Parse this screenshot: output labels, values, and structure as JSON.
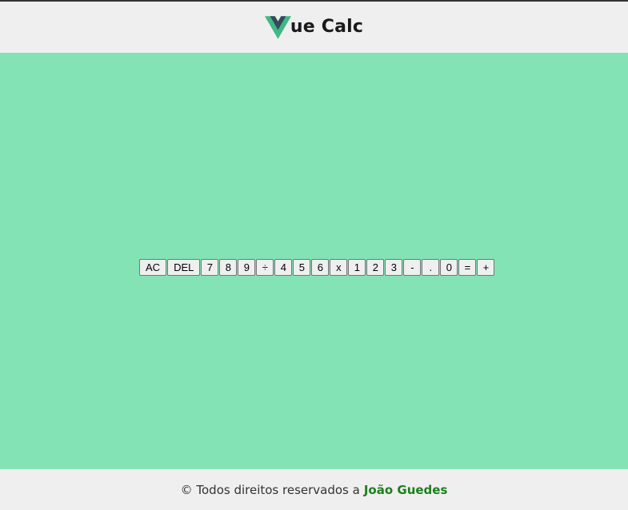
{
  "header": {
    "logo_icon": "vue-logo-icon",
    "title_rest": "ue Calc",
    "logo_colors": {
      "outer": "#41b883",
      "inner": "#35495e"
    }
  },
  "calculator": {
    "keys": [
      {
        "label": "AC",
        "name": "key-ac"
      },
      {
        "label": "DEL",
        "name": "key-del"
      },
      {
        "label": "7",
        "name": "key-7"
      },
      {
        "label": "8",
        "name": "key-8"
      },
      {
        "label": "9",
        "name": "key-9"
      },
      {
        "label": "÷",
        "name": "key-divide"
      },
      {
        "label": "4",
        "name": "key-4"
      },
      {
        "label": "5",
        "name": "key-5"
      },
      {
        "label": "6",
        "name": "key-6"
      },
      {
        "label": "x",
        "name": "key-multiply"
      },
      {
        "label": "1",
        "name": "key-1"
      },
      {
        "label": "2",
        "name": "key-2"
      },
      {
        "label": "3",
        "name": "key-3"
      },
      {
        "label": "-",
        "name": "key-subtract"
      },
      {
        "label": ".",
        "name": "key-decimal"
      },
      {
        "label": "0",
        "name": "key-0"
      },
      {
        "label": "=",
        "name": "key-equals"
      },
      {
        "label": "+",
        "name": "key-add"
      }
    ],
    "background_color": "#83e3b5"
  },
  "footer": {
    "copyright_text": "© Todos direitos reservados a",
    "author": "João Guedes",
    "author_color": "#1e7e1e"
  }
}
